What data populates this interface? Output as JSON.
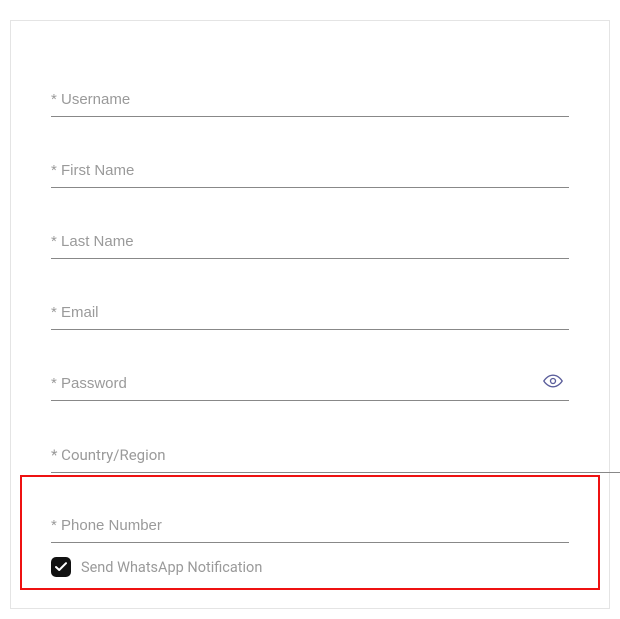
{
  "form": {
    "username": {
      "placeholder": "* Username",
      "value": ""
    },
    "first_name": {
      "placeholder": "* First Name",
      "value": ""
    },
    "last_name": {
      "placeholder": "* Last Name",
      "value": ""
    },
    "email": {
      "placeholder": "* Email",
      "value": ""
    },
    "password": {
      "placeholder": "* Password",
      "value": ""
    },
    "country": {
      "placeholder": "* Country/Region",
      "value": ""
    },
    "phone": {
      "placeholder": "* Phone Number",
      "value": ""
    },
    "whatsapp": {
      "label": "Send WhatsApp Notification",
      "checked": true
    }
  }
}
